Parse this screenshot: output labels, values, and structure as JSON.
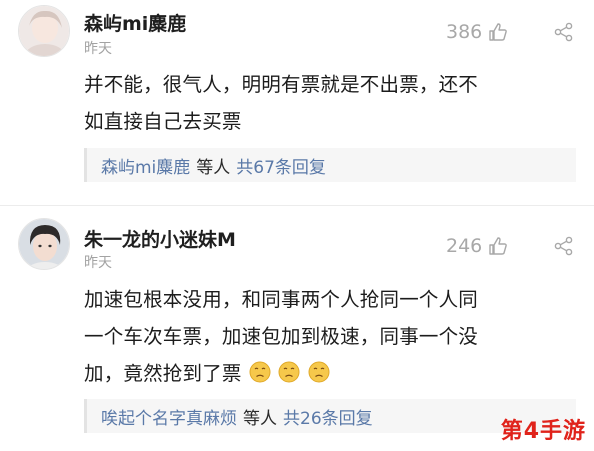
{
  "comments": [
    {
      "username": "森屿mi麋鹿",
      "timestamp": "昨天",
      "likes": "386",
      "body_lines": [
        "并不能，很气人，明明有票就是不出票，还不",
        "如直接自己去买票"
      ],
      "reply": {
        "name": "森屿mi麋鹿",
        "mid": "等人",
        "count": "共67条回复"
      }
    },
    {
      "username": "朱一龙的小迷妹M",
      "timestamp": "昨天",
      "likes": "246",
      "body_lines": [
        "加速包根本没用，和同事两个人抢同一个人同",
        "一个车次车票，加速包加到极速，同事一个没",
        "加，竟然抢到了票"
      ],
      "reply": {
        "name": "唉起个名字真麻烦",
        "mid": "等人",
        "count": "共26条回复"
      }
    }
  ],
  "icons": {
    "like": "thumbs-up-icon",
    "share": "share-icon",
    "emoji": "sad-face-emoji-icon"
  },
  "colors": {
    "link": "#5a79a8",
    "meta": "#a3a3a3",
    "watermark": "#e0231b"
  },
  "watermark": "第4手游"
}
